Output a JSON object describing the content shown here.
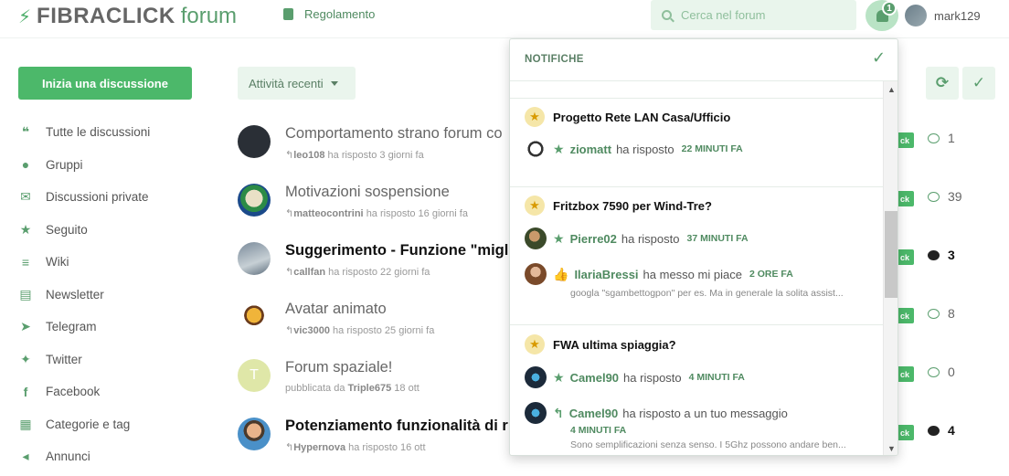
{
  "header": {
    "logo_strong": "FIBRACLICK",
    "logo_light": "forum",
    "regolamento": "Regolamento",
    "search_placeholder": "Cerca nel forum",
    "notif_count": "1",
    "username": "mark129"
  },
  "sidebar": {
    "start_button": "Inizia una discussione",
    "items": [
      {
        "label": "Tutte le discussioni",
        "icon": "chat-icon"
      },
      {
        "label": "Gruppi",
        "icon": "users-icon"
      },
      {
        "label": "Discussioni private",
        "icon": "envelope-icon"
      },
      {
        "label": "Seguito",
        "icon": "star-icon"
      },
      {
        "label": "Wiki",
        "icon": "list-icon"
      },
      {
        "label": "Newsletter",
        "icon": "newspaper-icon"
      },
      {
        "label": "Telegram",
        "icon": "telegram-icon"
      },
      {
        "label": "Twitter",
        "icon": "twitter-icon"
      },
      {
        "label": "Facebook",
        "icon": "facebook-icon"
      },
      {
        "label": "Categorie e tag",
        "icon": "grid-icon"
      },
      {
        "label": "Annunci",
        "icon": "megaphone-icon"
      }
    ]
  },
  "toolbar": {
    "filter_label": "Attività recenti"
  },
  "discussions": [
    {
      "title": "Comportamento strano forum co",
      "user": "leo108",
      "action": "ha risposto 3 giorni fa",
      "tag": "ck",
      "count": "1",
      "bold": false
    },
    {
      "title": "Motivazioni sospensione",
      "user": "matteocontrini",
      "action": "ha risposto 16 giorni fa",
      "tag": "ck",
      "count": "39",
      "bold": false
    },
    {
      "title": "Suggerimento - Funzione \"miglio",
      "user": "callfan",
      "action": "ha risposto 22 giorni fa",
      "tag": "ck",
      "count": "3",
      "bold": true
    },
    {
      "title": "Avatar animato",
      "user": "vic3000",
      "action": "ha risposto 25 giorni fa",
      "tag": "ck",
      "count": "8",
      "bold": false
    },
    {
      "title": "Forum spaziale!",
      "user": "Triple675",
      "action": "18 ott",
      "prefix": "pubblicata da",
      "tag": "ck",
      "count": "0",
      "bold": false
    },
    {
      "title": "Potenziamento funzionalità di ri",
      "user": "Hypernova",
      "action": "ha risposto 16 ott",
      "tag": "ck",
      "count": "4",
      "bold": true
    }
  ],
  "notifications": {
    "title": "NOTIFICHE",
    "groups": [
      {
        "title": "Progetto Rete LAN Casa/Ufficio",
        "items": [
          {
            "user": "ziomatt",
            "action": "ha risposto",
            "time": "22 MINUTI FA"
          }
        ]
      },
      {
        "title": "Fritzbox 7590 per Wind-Tre?",
        "items": [
          {
            "user": "Pierre02",
            "action": "ha risposto",
            "time": "37 MINUTI FA"
          },
          {
            "user": "IlariaBressi",
            "action": "ha messo mi piace",
            "time": "2 ORE FA",
            "excerpt": "googla \"sgambettogpon\" per es. Ma in generale la solita assist..."
          }
        ]
      },
      {
        "title": "FWA ultima spiaggia?",
        "items": [
          {
            "user": "Camel90",
            "action": "ha risposto",
            "time": "4 MINUTI FA"
          },
          {
            "user": "Camel90",
            "action": "ha risposto a un tuo messaggio",
            "time": "4 MINUTI FA",
            "excerpt": "Sono semplificazioni senza senso. I 5Ghz possono andare ben..."
          }
        ]
      }
    ]
  },
  "colors": {
    "accent": "#4cb86a",
    "accent_dark": "#5a9e6e",
    "light_green": "#eaf5ed"
  }
}
